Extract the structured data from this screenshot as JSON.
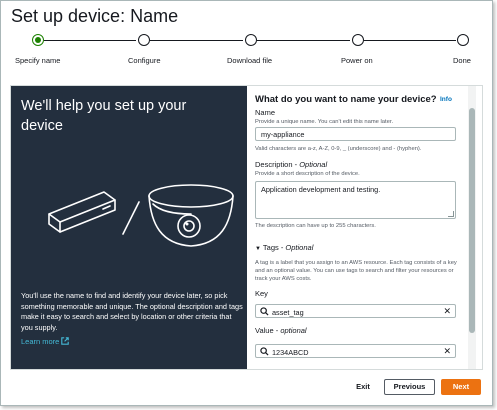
{
  "page": {
    "title": "Set up device: Name"
  },
  "steps": [
    {
      "label": "Specify name",
      "state": "done"
    },
    {
      "label": "Configure",
      "state": "todo"
    },
    {
      "label": "Download file",
      "state": "todo"
    },
    {
      "label": "Power on",
      "state": "todo"
    },
    {
      "label": "Done",
      "state": "todo"
    }
  ],
  "intro": {
    "heading": "We'll help you set up your device",
    "body": "You'll use the name to find and identify your device later, so pick something memorable and unique. The optional description and tags make it easy to search and select by location or other criteria that you supply.",
    "learn_more": "Learn more"
  },
  "form": {
    "heading": "What do you want to name your device?",
    "info": "Info",
    "name_label": "Name",
    "name_hint": "Provide a unique name. You can't edit this name later.",
    "name_value": "my-appliance",
    "name_constraint": "Valid characters are a-z, A-Z, 0-9, _ (underscore) and - (hyphen).",
    "desc_label": "Description",
    "desc_optional": "Optional",
    "desc_hint": "Provide a short description of the device.",
    "desc_value": "Application development and testing.",
    "desc_constraint": "The description can have up to 255 characters.",
    "tags_label": "Tags",
    "tags_optional": "Optional",
    "tags_hint": "A tag is a label that you assign to an AWS resource. Each tag consists of a key and an optional value. You can use tags to search and filter your resources or track your AWS costs.",
    "key_label": "Key",
    "key_value": "asset_tag",
    "value_label": "Value",
    "value_optional": "optional",
    "value_value": "1234ABCD"
  },
  "footer": {
    "exit": "Exit",
    "previous": "Previous",
    "next": "Next"
  },
  "colors": {
    "accent": "#ec7211",
    "success": "#1d8102",
    "panel_dark": "#232f3e",
    "link": "#0073bb"
  }
}
